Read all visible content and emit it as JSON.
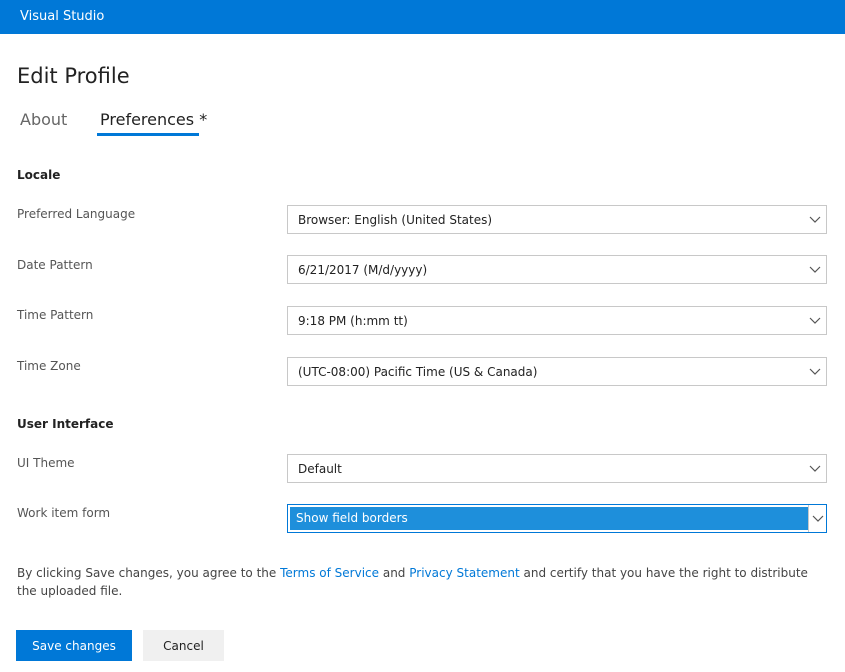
{
  "app": {
    "brand": "Visual Studio"
  },
  "page": {
    "title": "Edit Profile"
  },
  "tabs": [
    {
      "label": "About",
      "active": false
    },
    {
      "label": "Preferences *",
      "active": true
    }
  ],
  "sections": {
    "locale": {
      "heading": "Locale",
      "fields": [
        {
          "label": "Preferred Language",
          "value": "Browser: English (United States)"
        },
        {
          "label": "Date Pattern",
          "value": "6/21/2017 (M/d/yyyy)"
        },
        {
          "label": "Time Pattern",
          "value": "9:18 PM (h:mm tt)"
        },
        {
          "label": "Time Zone",
          "value": "(UTC-08:00) Pacific Time (US & Canada)"
        }
      ]
    },
    "ui": {
      "heading": "User Interface",
      "fields": [
        {
          "label": "UI Theme",
          "value": "Default"
        },
        {
          "label": "Work item form",
          "value": "Show field borders",
          "focused": true
        }
      ]
    }
  },
  "legal": {
    "prefix": "By clicking Save changes, you agree to the",
    "tos_link": "Terms of Service",
    "and": "and",
    "privacy_link": "Privacy Statement",
    "suffix": "and certify that you have the right to distribute the uploaded file."
  },
  "actions": {
    "save": "Save changes",
    "cancel": "Cancel"
  },
  "colors": {
    "accent": "#0078d7",
    "highlight": "#1e8fdb"
  }
}
